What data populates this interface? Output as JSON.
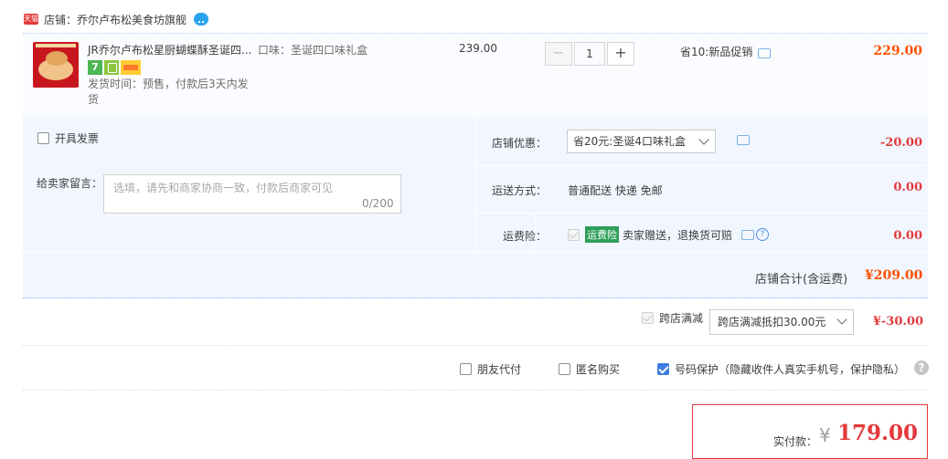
{
  "shop": {
    "badge": "天猫",
    "label": "店铺：乔尔卢布松美食坊旗舰"
  },
  "item": {
    "title": "JR乔尔卢布松星厨蝴蝶酥圣诞四...",
    "attr": "口味：圣诞四口味礼盒",
    "icon_names": [
      "seven-day-return-icon",
      "guarantee-icon",
      "card-icon"
    ],
    "seven_label": "7",
    "ship_time": "发货时间：预售，付款后3天内发货",
    "unit_price": "239.00",
    "qty": {
      "minus": "−",
      "value": "1",
      "plus": "+"
    },
    "promo": "省10:新品促销",
    "total": "229.00"
  },
  "order": {
    "invoice_label": "开具发票",
    "memo_label": "给卖家留言：",
    "memo_placeholder": "选填，请先和商家协商一致，付款后商家可见",
    "memo_count": "0/200",
    "shop_discount_label": "店铺优惠：",
    "shop_discount_value": "省20元:圣诞4口味礼盒",
    "shop_discount_amount": "-20.00",
    "shipping_label": "运送方式：",
    "shipping_value": "普通配送 快递 免邮",
    "shipping_amount": "0.00",
    "insurance_label": "运费险：",
    "insurance_badge": "运费险",
    "insurance_text": "卖家赠送，退换货可赔",
    "insurance_amount": "0.00",
    "subtotal_label": "店铺合计(含运费)",
    "subtotal_value": "¥209.00"
  },
  "cross_store": {
    "label": "跨店满减",
    "select_value": "跨店满减抵扣30.00元",
    "amount": "¥-30.00"
  },
  "options": {
    "friend_pay": "朋友代付",
    "anonymous": "匿名购买",
    "number_protect": "号码保护（隐藏收件人真实手机号，保护隐私）"
  },
  "payment": {
    "label": "实付款：",
    "currency": "¥",
    "value": "179.00"
  },
  "colors": {
    "price_orange": "#ff5000",
    "price_red": "#e4393c",
    "box_bg": "#f2f7ff",
    "check_blue": "#3d7ee0"
  }
}
